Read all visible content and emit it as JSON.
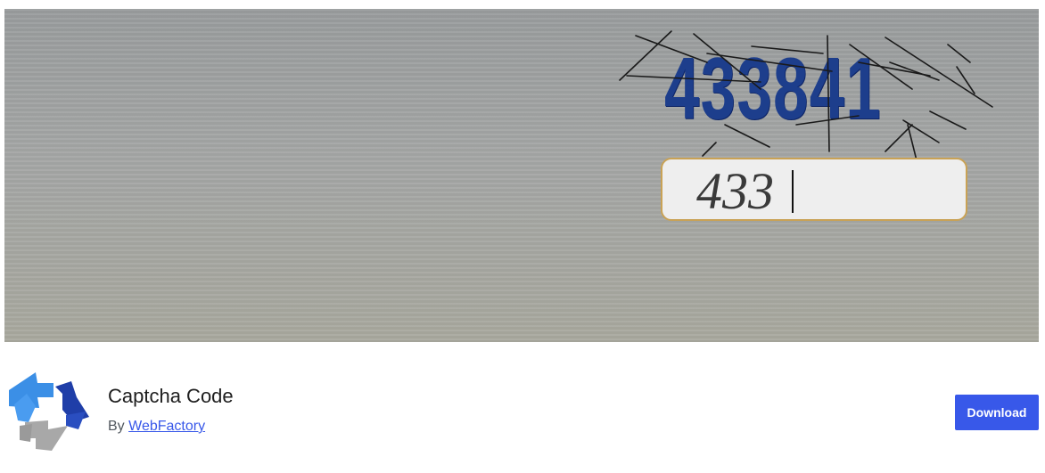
{
  "banner": {
    "captcha_code": "433841",
    "typed_value": "433"
  },
  "plugin": {
    "name": "Captcha Code",
    "by_label": "By",
    "author": "WebFactory",
    "icon": "plugin-arrows-icon"
  },
  "actions": {
    "download_label": "Download"
  },
  "colors": {
    "accent": "#3858e9",
    "captcha_text": "#1d3e8c",
    "input_border": "#c9a255"
  }
}
